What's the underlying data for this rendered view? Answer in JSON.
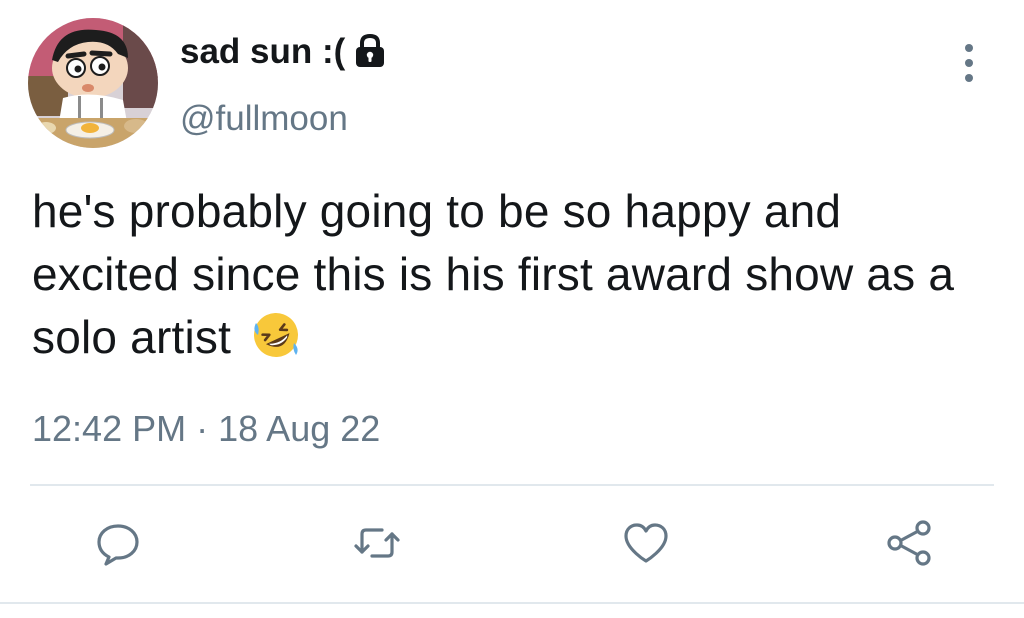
{
  "user": {
    "display_name": "sad sun :(",
    "handle": "@fullmoon",
    "avatar": "cartoon-boy-avatar",
    "protected_icon": "lock-icon"
  },
  "tweet": {
    "text": "he's probably going to be so happy and excited since this is his first award show as a solo artist",
    "emoji": "rolling-on-floor-laughing-emoji",
    "time": "12:42 PM",
    "separator": "·",
    "date": "18 Aug 22"
  },
  "actions": [
    {
      "icon": "reply-icon"
    },
    {
      "icon": "retweet-icon"
    },
    {
      "icon": "like-icon"
    },
    {
      "icon": "share-icon"
    }
  ],
  "colors": {
    "text": "#14171a",
    "secondary": "#657786",
    "divider": "#e1e8ed",
    "emoji_face": "#f8c83a",
    "avatar_bg": "#e7ecef"
  },
  "menu_icon": "more-options-icon"
}
